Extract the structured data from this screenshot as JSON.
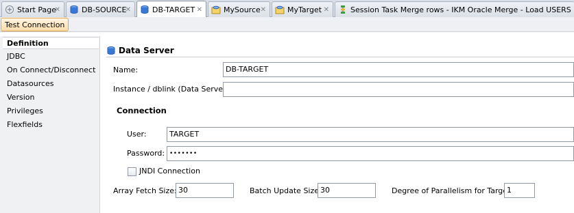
{
  "tabs": [
    {
      "label": "Start Page",
      "icon": "start-page-icon",
      "active": false
    },
    {
      "label": "DB-SOURCE",
      "icon": "database-icon",
      "active": false
    },
    {
      "label": "DB-TARGET",
      "icon": "database-icon",
      "active": true
    },
    {
      "label": "MySource",
      "icon": "schema-icon",
      "active": false
    },
    {
      "label": "MyTarget",
      "icon": "schema-icon",
      "active": false
    },
    {
      "label": "Session Task Merge rows - IKM Oracle Merge - Load USERS",
      "icon": "session-task-icon",
      "active": false
    }
  ],
  "toolbar": {
    "test_connection_label": "Test Connection"
  },
  "nav": {
    "items": [
      {
        "label": "Definition",
        "active": true
      },
      {
        "label": "JDBC",
        "active": false
      },
      {
        "label": "On Connect/Disconnect",
        "active": false
      },
      {
        "label": "Datasources",
        "active": false
      },
      {
        "label": "Version",
        "active": false
      },
      {
        "label": "Privileges",
        "active": false
      },
      {
        "label": "Flexfields",
        "active": false
      }
    ]
  },
  "data_server": {
    "title": "Data Server",
    "name_label": "Name:",
    "name_value": "DB-TARGET",
    "instance_label": "Instance / dblink (Data Server):",
    "instance_value": ""
  },
  "connection": {
    "title": "Connection",
    "user_label": "User:",
    "user_value": "TARGET",
    "password_label": "Password:",
    "password_value": "•••••••",
    "jndi_label": "JNDI Connection",
    "jndi_checked": false
  },
  "fetch": {
    "array_fetch_label": "Array Fetch Size:",
    "array_fetch_value": "30",
    "batch_update_label": "Batch Update Size:",
    "batch_update_value": "30",
    "parallelism_label": "Degree of Parallelism for Target:",
    "parallelism_value": "1"
  },
  "colors": {
    "accent": "#fbdca9",
    "tab_bar": "#d9dee6",
    "db_icon": "#3a78d6"
  }
}
